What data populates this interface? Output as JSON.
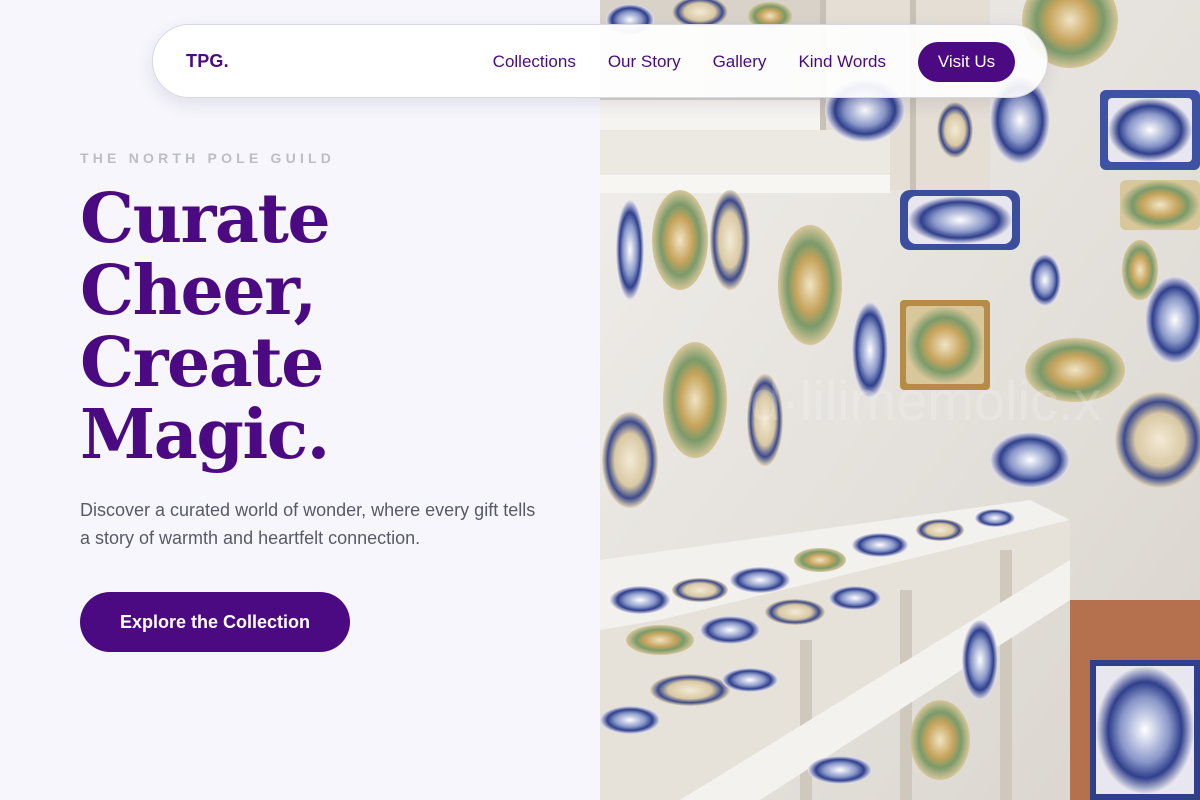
{
  "nav": {
    "logo": "TPG.",
    "links": [
      "Collections",
      "Our Story",
      "Gallery",
      "Kind Words"
    ],
    "cta_label": "Visit Us"
  },
  "hero": {
    "eyebrow": "THE NORTH POLE GUILD",
    "headline_lines": [
      "Curate",
      "Cheer,",
      "Create",
      "Magic."
    ],
    "subcopy": "Discover a curated world of wonder, where every gift tells a story of warmth and heartfelt connection.",
    "cta_label": "Explore the Collection"
  },
  "image": {
    "subject": "shop-interior-ceramic-plates-photo"
  },
  "colors": {
    "brand_purple": "#4b0a82",
    "page_bg": "#f6f6fc",
    "eyebrow_gray": "#bdbdc4",
    "body_text": "#5a5a66"
  }
}
